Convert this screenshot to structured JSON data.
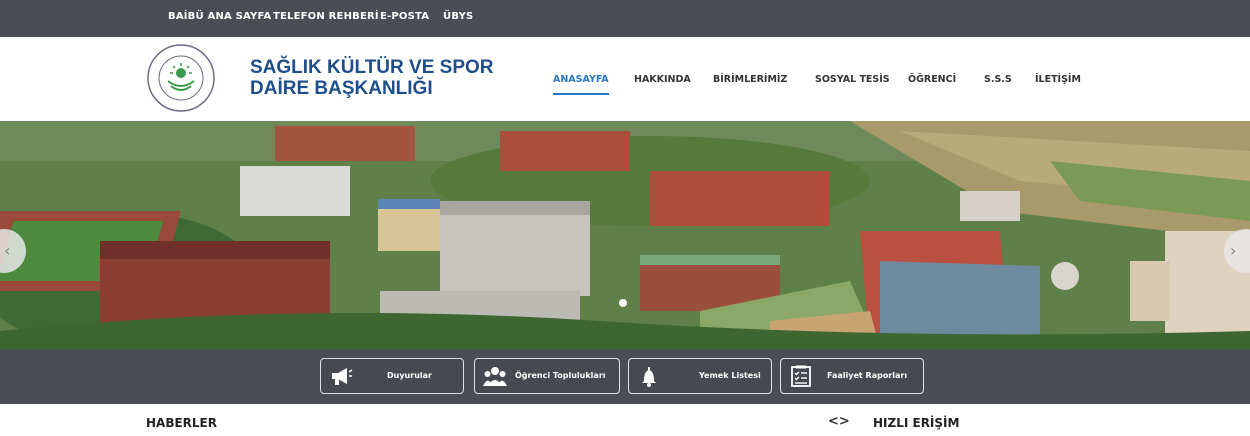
{
  "topbar": {
    "links": [
      "BAİBÜ ANA SAYFA",
      "TELEFON REHBERİ",
      "E-POSTA",
      "ÜBYS"
    ]
  },
  "header": {
    "title_line1": "SAĞLIK KÜLTÜR VE SPOR",
    "title_line2": "DAİRE BAŞKANLIĞI",
    "logo_text": "İZZET BAYSAL ÜNİVERSİTESİ BOLU ABANT",
    "brand_color": "#1f4e8c"
  },
  "nav": {
    "items": [
      "ANASAYFA",
      "HAKKINDA",
      "BİRİMLERİMİZ",
      "SOSYAL TESİS",
      "ÖĞRENCİ",
      "S.S.S",
      "İLETİŞİM"
    ],
    "active_color": "#2c77c4"
  },
  "hero": {
    "prev_icon": "chevron-left-icon",
    "next_icon": "chevron-right-icon"
  },
  "quick_links": [
    {
      "label": "Duyurular",
      "icon": "megaphone-icon"
    },
    {
      "label": "Öğrenci Toplulukları",
      "icon": "group-icon"
    },
    {
      "label": "Yemek Listesi",
      "icon": "bell-icon"
    },
    {
      "label": "Faaliyet Raporları",
      "icon": "report-icon"
    }
  ],
  "sections": {
    "news_title": "HABERLER",
    "quick_access_arrows": "<>",
    "quick_access_title": "HIZLI ERİŞİM"
  }
}
